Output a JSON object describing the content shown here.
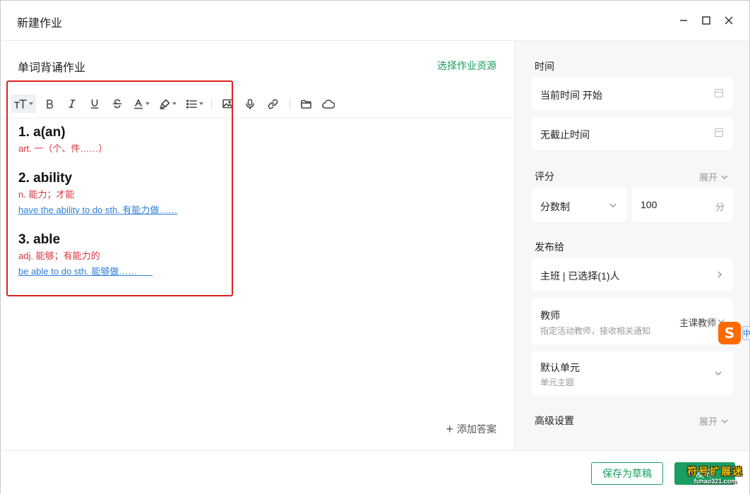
{
  "window": {
    "title": "新建作业"
  },
  "homework": {
    "title": "单词背诵作业",
    "select_resource": "选择作业资源"
  },
  "toolbar": {
    "icons": [
      "font-size-icon",
      "bold-icon",
      "italic-icon",
      "underline-icon",
      "strikethrough-icon",
      "font-color-icon",
      "highlight-icon",
      "list-icon",
      "image-icon",
      "microphone-icon",
      "link-icon",
      "folder-icon",
      "cloud-icon"
    ]
  },
  "entries": [
    {
      "word": "1. a(an)",
      "meaning": "art. 一（个、件……）",
      "example": ""
    },
    {
      "word": "2. ability",
      "meaning": "n. 能力；才能",
      "example": "have the ability to do sth. 有能力做……"
    },
    {
      "word": "3. able",
      "meaning": "adj. 能够；有能力的",
      "example": "be able to do sth. 能够做……      "
    }
  ],
  "add_answer": "添加答案",
  "sidebar": {
    "time": {
      "label": "时间",
      "start": "当前时间 开始",
      "end": "无截止时间"
    },
    "score": {
      "label": "评分",
      "expand": "展开",
      "system": "分数制",
      "value": "100",
      "unit": "分"
    },
    "publish": {
      "label": "发布给",
      "target": "主班 | 已选择(1)人"
    },
    "teacher": {
      "title": "教师",
      "subtitle": "指定活动教师，接收相关通知",
      "value": "主课教师"
    },
    "unit": {
      "title": "默认单元",
      "subtitle": "单元主题"
    },
    "advanced": {
      "label": "高级设置",
      "expand": "展开"
    }
  },
  "footer": {
    "save_draft": "保存为草稿",
    "publish": "发布"
  },
  "overlay": {
    "ime_letter": "S",
    "ime_lang": "中",
    "watermark_top": "符号扩展迷",
    "watermark_bottom": "fuhao321.com"
  },
  "colors": {
    "accent": "#1a9e5f",
    "meaning": "#d9363e",
    "example": "#2f7fd8",
    "highlight_box": "#e02020"
  }
}
